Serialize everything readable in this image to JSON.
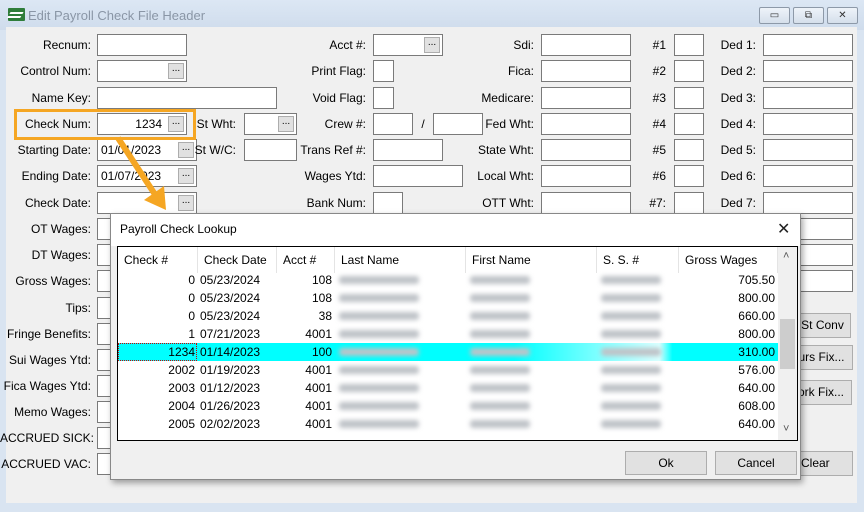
{
  "window": {
    "title": "Edit Payroll Check File Header",
    "minimize": "▭",
    "restore": "⧉",
    "close": "✕"
  },
  "left_fields": [
    {
      "label": "Recnum:",
      "value": ""
    },
    {
      "label": "Control Num:",
      "value": "",
      "lookup": true
    },
    {
      "label": "Name Key:",
      "value": ""
    },
    {
      "label": "Check Num:",
      "value": "1234",
      "lookup": true
    },
    {
      "label": "Starting Date:",
      "value": "01/01/2023",
      "lookup": true
    },
    {
      "label": "Ending Date:",
      "value": "01/07/2023",
      "lookup": true
    },
    {
      "label": "Check Date:",
      "value": "",
      "lookup": true
    },
    {
      "label": "OT Wages:",
      "value": ""
    },
    {
      "label": "DT Wages:",
      "value": ""
    },
    {
      "label": "Gross Wages:",
      "value": ""
    },
    {
      "label": "Tips:",
      "value": ""
    },
    {
      "label": "Fringe Benefits:",
      "value": ""
    },
    {
      "label": "Sui Wages Ytd:",
      "value": ""
    },
    {
      "label": "Fica Wages Ytd:",
      "value": ""
    },
    {
      "label": "Memo Wages:",
      "value": ""
    },
    {
      "label": "ACCRUED SICK:",
      "value": ""
    },
    {
      "label": "ACCRUED VAC:",
      "value": ""
    }
  ],
  "st_fields": [
    {
      "label": "St Wht:",
      "value": ""
    },
    {
      "label": "St W/C:",
      "value": ""
    }
  ],
  "mid_fields": [
    {
      "label": "Acct #:",
      "value": ""
    },
    {
      "label": "Print Flag:",
      "value": ""
    },
    {
      "label": "Void Flag:",
      "value": ""
    },
    {
      "label": "Crew #:",
      "value": "",
      "separator": "/"
    },
    {
      "label": "Trans Ref #:",
      "value": ""
    },
    {
      "label": "Wages Ytd:",
      "value": ""
    },
    {
      "label": "Bank Num:",
      "value": ""
    }
  ],
  "tax_fields": [
    "Sdi:",
    "Fica:",
    "Medicare:",
    "Fed Wht:",
    "State Wht:",
    "Local Wht:",
    "OTT Wht:"
  ],
  "num_labels": [
    "#1",
    "#2",
    "#3",
    "#4",
    "#5",
    "#6",
    "#7:"
  ],
  "ded_labels": [
    "Ded 1:",
    "Ded 2:",
    "Ded 3:",
    "Ded 4:",
    "Ded 5:",
    "Ded 6:",
    "Ded 7:"
  ],
  "side_buttons": {
    "st_conv": "-St Conv",
    "hours_fix": "urs Fix...",
    "work_fix": "ork Fix...",
    "clear": "Clear"
  },
  "lookup_ellipsis": "...",
  "dialog": {
    "title": "Payroll Check Lookup",
    "close": "✕",
    "columns": [
      "Check #",
      "Check Date",
      "Acct #",
      "Last Name",
      "First Name",
      "S. S. #",
      "Gross Wages"
    ],
    "rows": [
      {
        "check": "0",
        "date": "05/23/2024",
        "acct": "108",
        "gross": "705.50"
      },
      {
        "check": "0",
        "date": "05/23/2024",
        "acct": "108",
        "gross": "800.00"
      },
      {
        "check": "0",
        "date": "05/23/2024",
        "acct": "38",
        "gross": "660.00"
      },
      {
        "check": "1",
        "date": "07/21/2023",
        "acct": "4001",
        "gross": "800.00"
      },
      {
        "check": "1234",
        "date": "01/14/2023",
        "acct": "100",
        "gross": "310.00",
        "selected": true
      },
      {
        "check": "2002",
        "date": "01/19/2023",
        "acct": "4001",
        "gross": "576.00"
      },
      {
        "check": "2003",
        "date": "01/12/2023",
        "acct": "4001",
        "gross": "640.00"
      },
      {
        "check": "2004",
        "date": "01/26/2023",
        "acct": "4001",
        "gross": "608.00"
      },
      {
        "check": "2005",
        "date": "02/02/2023",
        "acct": "4001",
        "gross": "640.00"
      }
    ],
    "ok": "Ok",
    "cancel": "Cancel",
    "scroll_up": "˄",
    "scroll_down": "˅"
  },
  "colors": {
    "selected_row": "#00ffff",
    "highlight": "#f5a623"
  }
}
